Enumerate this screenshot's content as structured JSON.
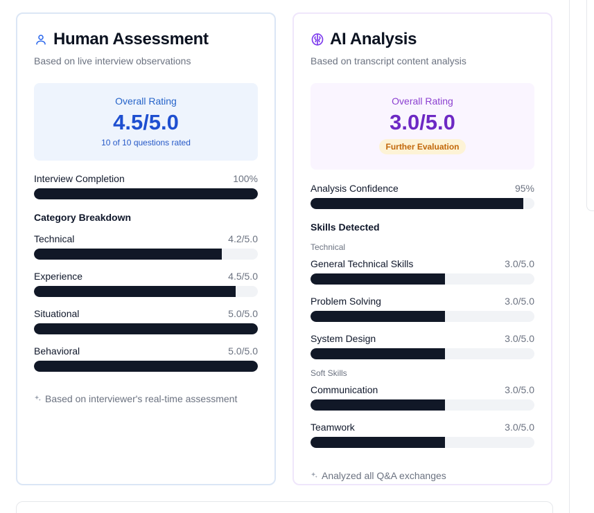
{
  "human": {
    "title": "Human Assessment",
    "subtitle": "Based on live interview observations",
    "overall_label": "Overall Rating",
    "overall_value": "4.5/5.0",
    "overall_note": "10 of 10 questions rated",
    "completion": {
      "label": "Interview Completion",
      "value": "100%",
      "fraction": 1.0
    },
    "breakdown_title": "Category Breakdown",
    "categories": [
      {
        "label": "Technical",
        "value": "4.2/5.0",
        "fraction": 0.84
      },
      {
        "label": "Experience",
        "value": "4.5/5.0",
        "fraction": 0.9
      },
      {
        "label": "Situational",
        "value": "5.0/5.0",
        "fraction": 1.0
      },
      {
        "label": "Behavioral",
        "value": "5.0/5.0",
        "fraction": 1.0
      }
    ],
    "footer": "Based on interviewer's real-time assessment",
    "accent": "#1e4fd0"
  },
  "ai": {
    "title": "AI Analysis",
    "subtitle": "Based on transcript content analysis",
    "overall_label": "Overall Rating",
    "overall_value": "3.0/5.0",
    "badge": "Further Evaluation",
    "confidence": {
      "label": "Analysis Confidence",
      "value": "95%",
      "fraction": 0.95
    },
    "skills_title": "Skills Detected",
    "technical_label": "Technical",
    "technical_skills": [
      {
        "label": "General Technical Skills",
        "value": "3.0/5.0",
        "fraction": 0.6
      },
      {
        "label": "Problem Solving",
        "value": "3.0/5.0",
        "fraction": 0.6
      },
      {
        "label": "System Design",
        "value": "3.0/5.0",
        "fraction": 0.6
      }
    ],
    "soft_label": "Soft Skills",
    "soft_skills": [
      {
        "label": "Communication",
        "value": "3.0/5.0",
        "fraction": 0.6
      },
      {
        "label": "Teamwork",
        "value": "3.0/5.0",
        "fraction": 0.6
      }
    ],
    "footer": "Analyzed all Q&A exchanges",
    "accent": "#6d28c4"
  },
  "icons": {
    "human": "user-icon",
    "ai": "brain-icon",
    "footer": "sparkles-icon"
  }
}
